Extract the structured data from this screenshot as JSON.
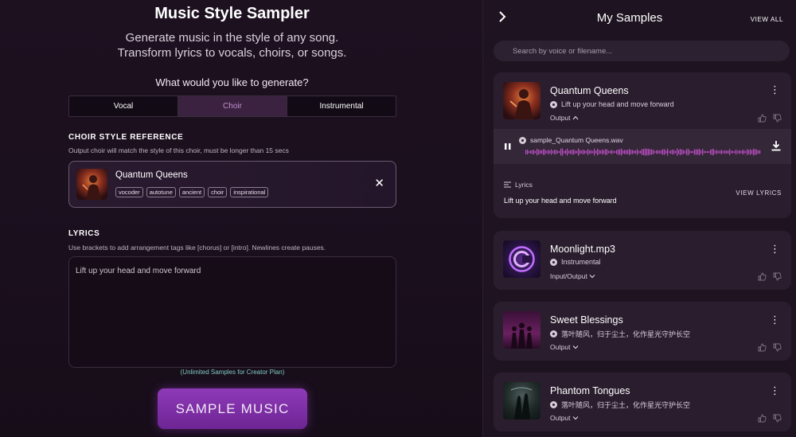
{
  "main": {
    "title": "Music Style Sampler",
    "subtitle_line1": "Generate music in the style of any song.",
    "subtitle_line2": "Transform lyrics to vocals, choirs, or songs.",
    "question": "What would you like to generate?",
    "tabs": [
      {
        "label": "Vocal",
        "active": false
      },
      {
        "label": "Choir",
        "active": true
      },
      {
        "label": "Instrumental",
        "active": false
      }
    ],
    "choir_ref": {
      "label": "CHOIR STYLE REFERENCE",
      "help": "Output choir will match the style of this choir, must be longer than 15 secs",
      "name": "Quantum Queens",
      "tags": [
        "vocoder",
        "autotune",
        "ancient",
        "choir",
        "inspirational"
      ],
      "close_icon": "close-icon"
    },
    "lyrics": {
      "label": "LYRICS",
      "help": "Use brackets to add arrangement tags like [chorus] or [intro]. Newlines create pauses.",
      "value": "Lift up your head and move forward"
    },
    "plan_note": "(Unlimited Samples for Creator Plan)",
    "sample_button": "SAMPLE MUSIC"
  },
  "panel": {
    "title": "My Samples",
    "view_all": "VIEW ALL",
    "search_placeholder": "Search by voice or filename...",
    "cards": [
      {
        "title": "Quantum Queens",
        "subtitle": "Lift up your head and move forward",
        "output_label": "Output",
        "expanded": true,
        "file": "sample_Quantum Queens.wav",
        "lyrics_label": "Lyrics",
        "lyrics_text": "Lift up your head and move forward",
        "view_lyrics": "VIEW LYRICS"
      },
      {
        "title": "Moonlight.mp3",
        "subtitle": "Instrumental",
        "output_label": "Input/Output"
      },
      {
        "title": "Sweet Blessings",
        "subtitle": "落叶随风，归于尘土，化作星光守护长空",
        "output_label": "Output"
      },
      {
        "title": "Phantom Tongues",
        "subtitle": "落叶随风，归于尘土，化作星光守护长空",
        "output_label": "Output"
      }
    ]
  },
  "colors": {
    "accent": "#8e3ab8",
    "active_tab_text": "#c48fd0",
    "waveform": "#c04ec9",
    "plan_note": "#7ec9c0"
  }
}
